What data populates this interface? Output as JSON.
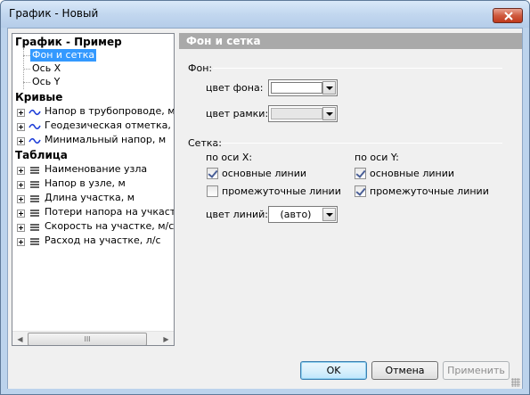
{
  "window": {
    "title": "График - Новый"
  },
  "tree": {
    "root": "График - Пример",
    "root_children": [
      "Фон и сетка",
      "Ось X",
      "Ось Y"
    ],
    "curves_header": "Кривые",
    "curves": [
      "Напор в трубопроводе, м",
      "Геодезическая отметка, м",
      "Минимальный напор, м"
    ],
    "table_header": "Таблица",
    "table": [
      "Наименование узла",
      "Напор в узле, м",
      "Длина участка, м",
      "Потери напора на учкастке",
      "Скорость на участке, м/с",
      "Расход на участке, л/с"
    ],
    "scroll_thumb": "III"
  },
  "panel": {
    "title": "Фон и сетка",
    "bg_group": "Фон:",
    "bg_color_label": "цвет фона:",
    "frame_color_label": "цвет рамки:",
    "grid_group": "Сетка:",
    "x_axis_label": "по оси X:",
    "y_axis_label": "по оси Y:",
    "x_main": {
      "label": "основные линии",
      "checked": true
    },
    "x_inter": {
      "label": "промежуточные линии",
      "checked": false
    },
    "y_main": {
      "label": "основные линии",
      "checked": true
    },
    "y_inter": {
      "label": "промежуточные линии",
      "checked": true
    },
    "line_color_label": "цвет линий:",
    "line_color_value": "(авто)"
  },
  "buttons": {
    "ok": "OK",
    "cancel": "Отмена",
    "apply": "Применить"
  },
  "colors": {
    "selection": "#3399ff",
    "panel_header": "#a9a9a9",
    "curve_icon": "#1f3fd8"
  }
}
